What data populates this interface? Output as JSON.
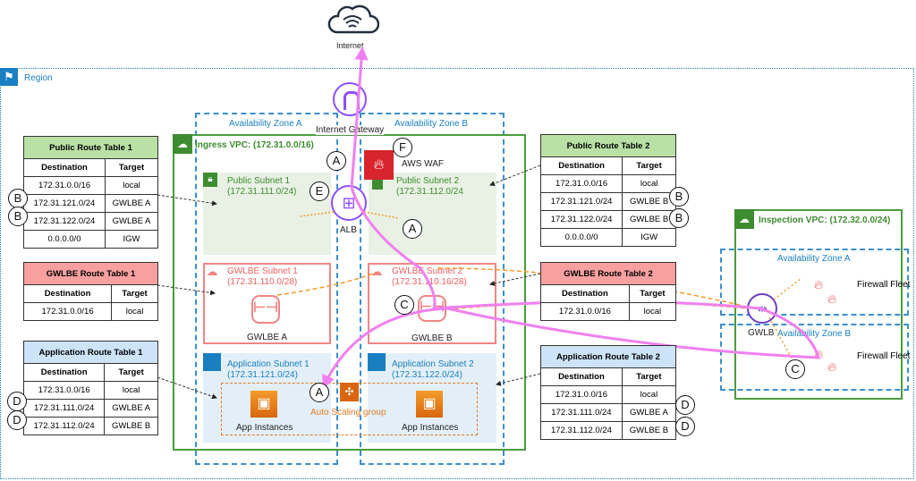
{
  "internet": {
    "label": "Internet"
  },
  "region": {
    "label": "Region"
  },
  "igw": {
    "label": "Internet Gateway"
  },
  "az": {
    "a": "Availability Zone A",
    "b": "Availability Zone B"
  },
  "ingress_vpc": {
    "title": "Ingress VPC: (172.31.0.0/16)"
  },
  "subnets": {
    "public1": {
      "name": "Public Subnet 1",
      "cidr": "(172.31.111.0/24)"
    },
    "public2": {
      "name": "Public Subnet 2",
      "cidr": "(172.31.112.0/24"
    },
    "gwlbe1": {
      "name": "GWLBE Subnet 1",
      "cidr": "(172.31.110.0/28)"
    },
    "gwlbe2": {
      "name": "GWLBE Subnet 2",
      "cidr": "(172.31.110.16/28)"
    },
    "app1": {
      "name": "Application Subnet 1",
      "cidr": "(172.31.121.0/24)"
    },
    "app2": {
      "name": "Application Subnet 2",
      "cidr": "(172.31.122.0/24)"
    }
  },
  "components": {
    "alb": "ALB",
    "waf": "AWS WAF",
    "gwlbe_a": "GWLBE A",
    "gwlbe_b": "GWLBE B",
    "app_instances": "App Instances",
    "asg": "Auto Scaling group",
    "gwlb": "GWLB",
    "firewall_fleet": "Firewall Fleet"
  },
  "inspection_vpc": {
    "title": "Inspection VPC: (172.32.0.0/24)",
    "az_a": "Availability Zone A",
    "az_b": "Availability Zone B"
  },
  "tables": {
    "headers": {
      "destination": "Destination",
      "target": "Target"
    },
    "public1": {
      "title": "Public Route Table 1",
      "color": "#b9e0a5",
      "rows": [
        [
          "172.31.0.0/16",
          "local"
        ],
        [
          "172.31.121.0/24",
          "GWLBE A"
        ],
        [
          "172.31.122.0/24",
          "GWLBE A"
        ],
        [
          "0.0.0.0/0",
          "IGW"
        ]
      ]
    },
    "gwlbe1": {
      "title": "GWLBE Route Table 1",
      "color": "#f8a0a0",
      "rows": [
        [
          "172.31.0.0/16",
          "local"
        ]
      ]
    },
    "app1": {
      "title": "Application Route Table 1",
      "color": "#cce3f8",
      "rows": [
        [
          "172.31.0.0/16",
          "local"
        ],
        [
          "172.31.111.0/24",
          "GWLBE A"
        ],
        [
          "172.31.112.0/24",
          "GWLBE B"
        ]
      ]
    },
    "public2": {
      "title": "Public Route Table 2",
      "color": "#b9e0a5",
      "rows": [
        [
          "172.31.0.0/16",
          "local"
        ],
        [
          "172.31.121.0/24",
          "GWLBE B"
        ],
        [
          "172.31.122.0/24",
          "GWLBE B"
        ],
        [
          "0.0.0.0/0",
          "IGW"
        ]
      ]
    },
    "gwlbe2": {
      "title": "GWLBE Route Table 2",
      "color": "#f8a0a0",
      "rows": [
        [
          "172.31.0.0/16",
          "local"
        ]
      ]
    },
    "app2": {
      "title": "Application Route Table 2",
      "color": "#cce3f8",
      "rows": [
        [
          "172.31.0.0/16",
          "local"
        ],
        [
          "172.31.111.0/24",
          "GWLBE A"
        ],
        [
          "172.31.112.0/24",
          "GWLBE B"
        ]
      ]
    }
  },
  "markers": {
    "a": "A",
    "b": "B",
    "c": "C",
    "d": "D",
    "e": "E",
    "f": "F"
  },
  "colors": {
    "flow": "#f080f0",
    "orange": "#f39b2a",
    "green": "#3d8c2f",
    "blue": "#1a7fc1",
    "purple": "#8c4fff"
  }
}
